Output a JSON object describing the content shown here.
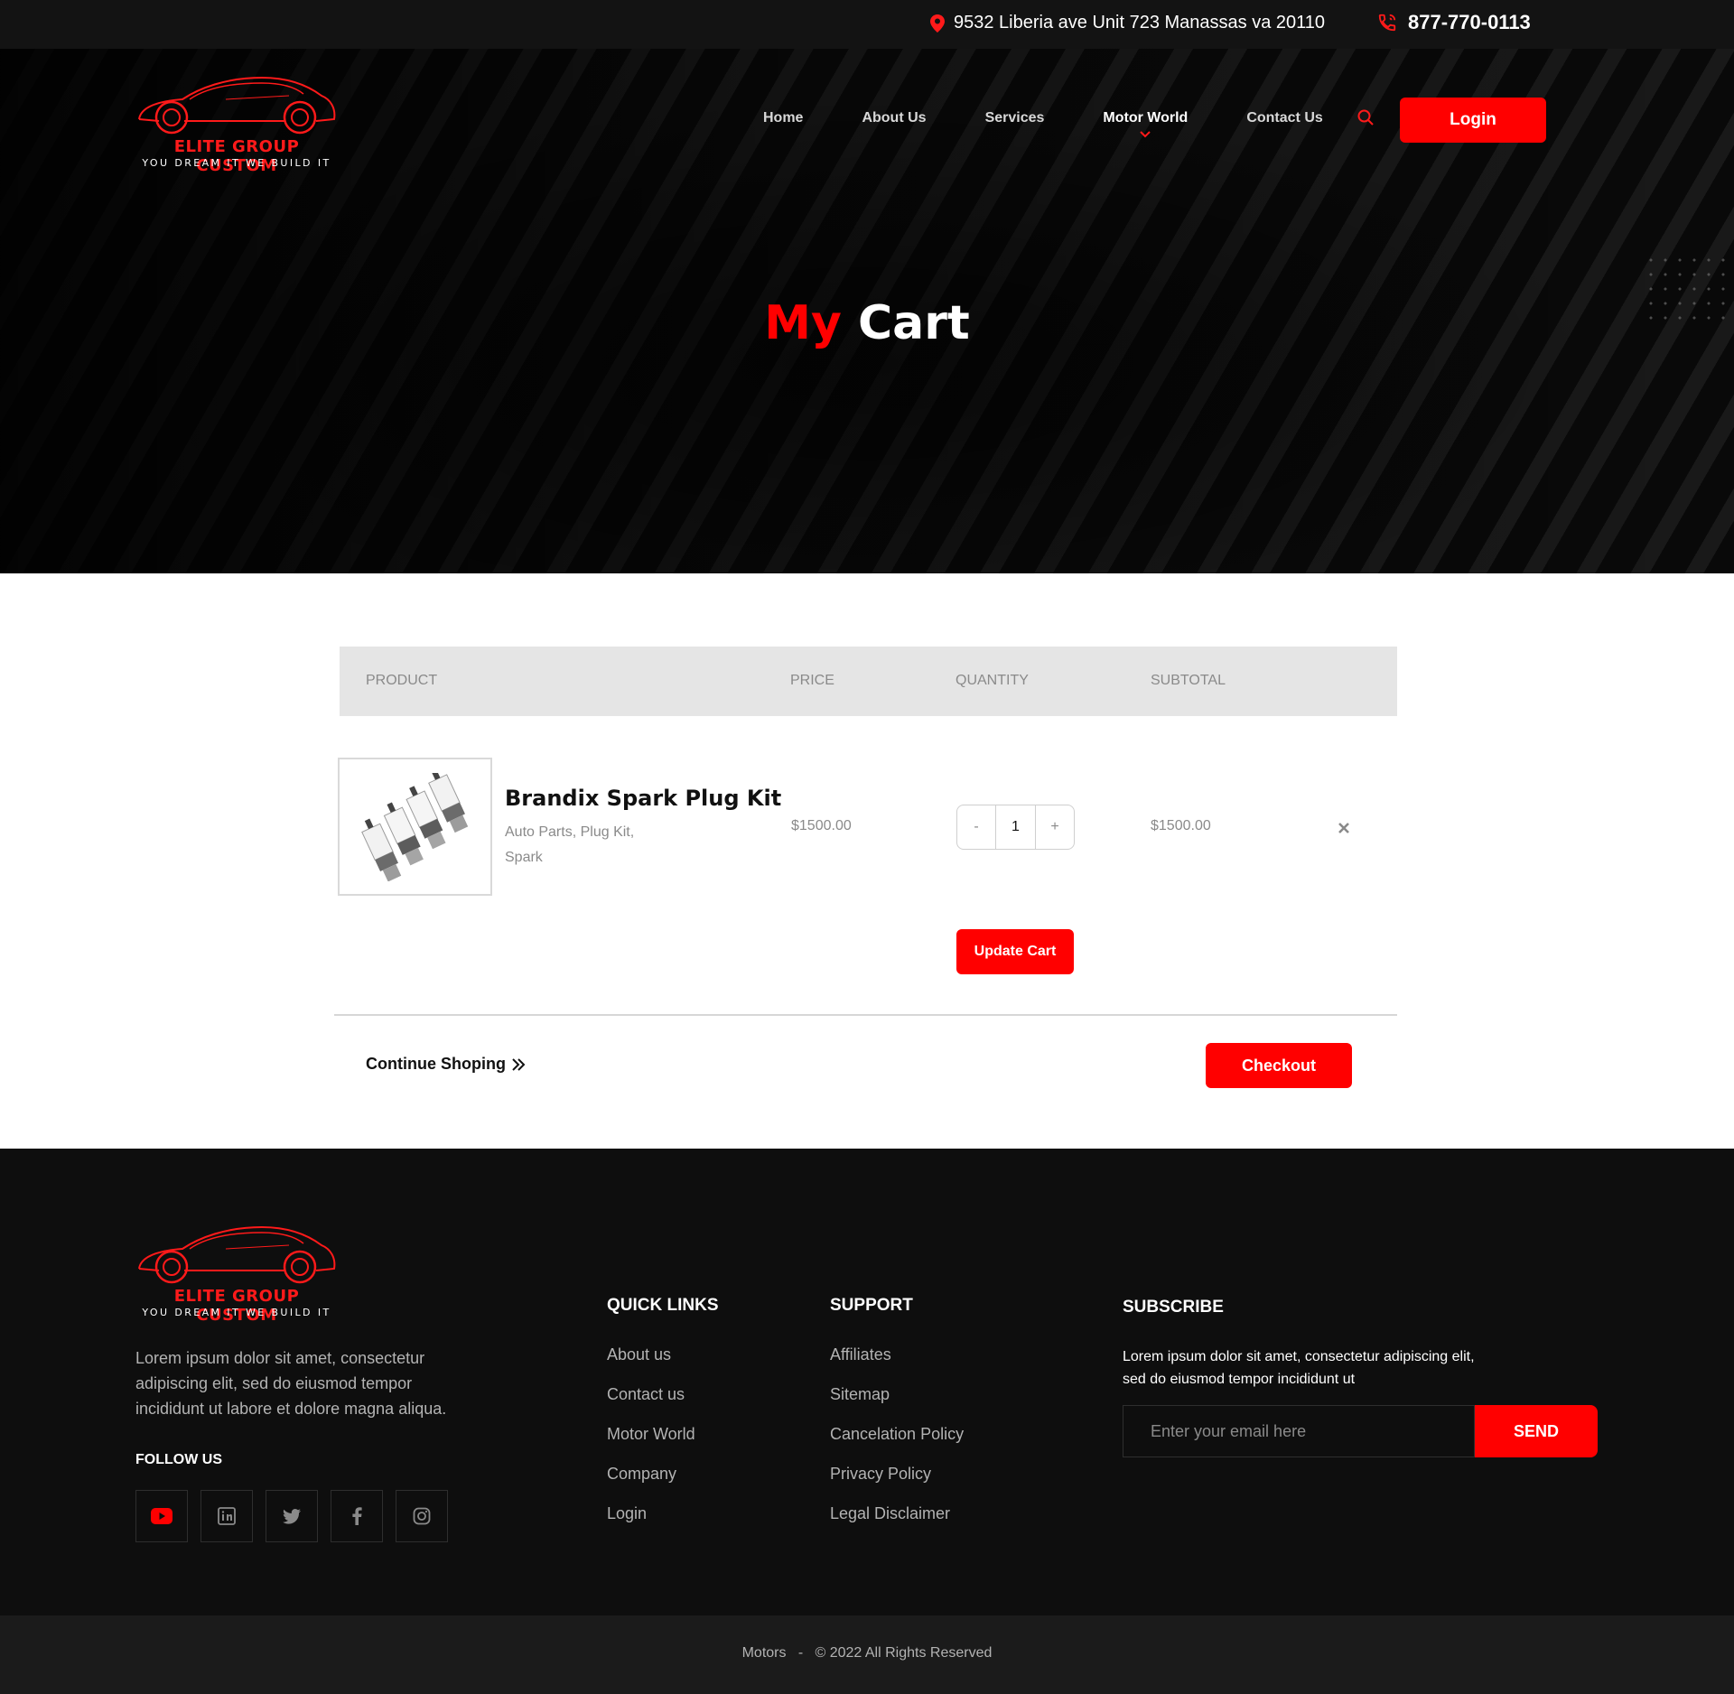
{
  "topbar": {
    "address": "9532 Liberia ave Unit 723 Manassas va 20110",
    "phone": "877-770-0113",
    "location_icon": "map-pin-icon",
    "phone_icon": "phone-icon"
  },
  "brand": {
    "name": "ELITE GROUP CUSTOM",
    "tagline": "YOU DREAM IT WE BUILD IT"
  },
  "nav": {
    "items": [
      {
        "label": "Home"
      },
      {
        "label": "About Us"
      },
      {
        "label": "Services"
      },
      {
        "label": "Motor World"
      },
      {
        "label": "Contact Us"
      }
    ],
    "active": "Motor World",
    "login_label": "Login"
  },
  "hero": {
    "title_red": "My",
    "title_white": "Cart"
  },
  "cart": {
    "headers": {
      "product": "PRODUCT",
      "price": "PRICE",
      "quantity": "QUANTITY",
      "subtotal": "SUBTOTAL"
    },
    "items": [
      {
        "name": "Brandix Spark Plug Kit",
        "categories": "Auto Parts, Plug Kit, Spark",
        "price": "$1500.00",
        "quantity": "1",
        "subtotal": "$1500.00"
      }
    ],
    "qty_minus": "-",
    "qty_plus": "+",
    "update_label": "Update Cart",
    "continue_label": "Continue Shoping",
    "checkout_label": "Checkout"
  },
  "footer": {
    "about": "Lorem ipsum dolor sit amet, consectetur adipiscing elit, sed do eiusmod tempor incididunt ut labore et dolore magna aliqua.",
    "follow_label": "FOLLOW US",
    "socials": [
      "youtube-icon",
      "linkedin-icon",
      "twitter-icon",
      "facebook-icon",
      "instagram-icon"
    ],
    "quick_links": {
      "title": "QUICK LINKS",
      "items": [
        "About us",
        "Contact us",
        "Motor World",
        "Company",
        "Login"
      ]
    },
    "support": {
      "title": "SUPPORT",
      "items": [
        "Affiliates",
        "Sitemap",
        "Cancelation Policy",
        "Privacy Policy",
        "Legal Disclaimer"
      ]
    },
    "subscribe": {
      "title": "SUBSCRIBE",
      "text": "Lorem ipsum dolor sit amet, consectetur adipiscing elit, sed do eiusmod tempor incididunt ut",
      "placeholder": "Enter your email here",
      "send_label": "SEND"
    },
    "copyright": "Motors   -   © 2022 All Rights Reserved"
  },
  "colors": {
    "accent": "#ff0000",
    "topbar": "#131313",
    "footer": "#0e0e0e",
    "copybar": "#1b1b1b",
    "table_header": "#e5e5e5"
  }
}
